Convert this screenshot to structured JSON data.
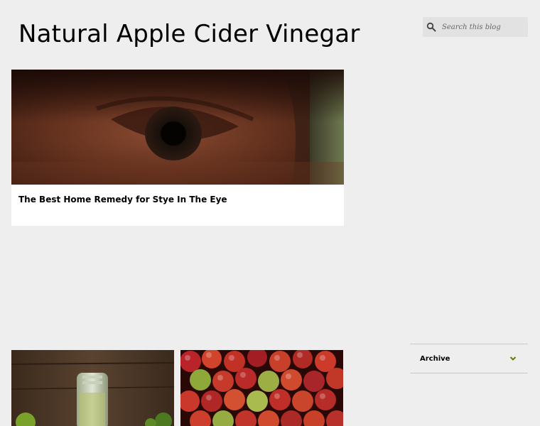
{
  "blog": {
    "title": "Natural Apple Cider Vinegar"
  },
  "search": {
    "placeholder": "Search this blog",
    "icon": "search-icon"
  },
  "featured_post": {
    "title": "The Best Home Remedy for Stye In The Eye"
  },
  "sidebar": {
    "archive_label": "Archive",
    "chevron_icon": "chevron-down-icon",
    "accent_color": "#6b7a00"
  },
  "posts": [
    {
      "thumbnail": "bottle-photo"
    },
    {
      "thumbnail": "apples-photo"
    }
  ]
}
